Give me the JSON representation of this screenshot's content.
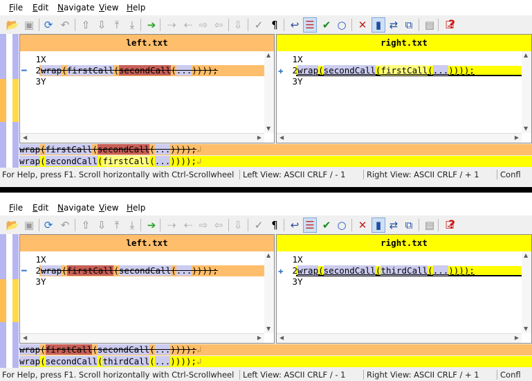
{
  "menu": [
    "File",
    "Edit",
    "Navigate",
    "View",
    "Help"
  ],
  "menu_mnemonics": [
    "F",
    "E",
    "N",
    "V",
    "H"
  ],
  "toolbar_icons": [
    "open-folder-icon",
    "save-icon",
    "refresh-icon",
    "undo-icon",
    "prev-diff-icon",
    "next-diff-icon",
    "first-diff-icon",
    "last-diff-icon",
    "current-diff-icon",
    "copy-left-icon",
    "copy-right-icon",
    "copy-all-icon",
    "prev-conflict-icon",
    "next-conflict-icon",
    "beautify-icon",
    "show-whitespace-icon",
    "word-wrap-icon",
    "view-diffs-icon",
    "check-icon",
    "circle-icon",
    "delete-icon",
    "toggle-panes-icon",
    "swap-panes-icon",
    "compare-icon",
    "options-icon",
    "report-icon",
    "help-icon"
  ],
  "colors": {
    "left_bg": "#ffbe6b",
    "right_bg": "#ffff00",
    "deleted": "#c86058",
    "changed": "#ccccf0",
    "added": "#ffff80",
    "location_pane": "#b6b6f0"
  },
  "shots": [
    {
      "left_title": "left.txt",
      "right_title": "right.txt",
      "left_lines": [
        {
          "num": "1",
          "segments": [
            {
              "text": "X",
              "style": "plain"
            }
          ]
        },
        {
          "num": "2",
          "segments": [
            {
              "text": "wrap",
              "style": "mod strike"
            },
            {
              "text": "(",
              "style": "strike"
            },
            {
              "text": "firstCall",
              "style": "mod strike"
            },
            {
              "text": "(",
              "style": "strike"
            },
            {
              "text": "secondCall",
              "style": "del strike"
            },
            {
              "text": "(",
              "style": "strike"
            },
            {
              "text": "...",
              "style": "mod strike"
            },
            {
              "text": "))));",
              "style": "strike"
            }
          ]
        },
        {
          "num": "3",
          "segments": [
            {
              "text": "Y",
              "style": "plain"
            }
          ]
        }
      ],
      "right_lines": [
        {
          "num": "1",
          "segments": [
            {
              "text": "X",
              "style": "plain"
            }
          ]
        },
        {
          "num": "2",
          "segments": [
            {
              "text": "wrap",
              "style": "mod uline"
            },
            {
              "text": "(",
              "style": "uline"
            },
            {
              "text": "secondCall",
              "style": "mod uline"
            },
            {
              "text": "(",
              "style": "uline"
            },
            {
              "text": "firstCall",
              "style": "add uline"
            },
            {
              "text": "(",
              "style": "uline"
            },
            {
              "text": "...",
              "style": "mod uline"
            },
            {
              "text": "))));",
              "style": "uline"
            }
          ]
        },
        {
          "num": "3",
          "segments": [
            {
              "text": "Y",
              "style": "plain"
            }
          ]
        }
      ],
      "detail_left": [
        {
          "text": "wrap",
          "style": "mod strike"
        },
        {
          "text": "(",
          "style": "strike"
        },
        {
          "text": "firstCall",
          "style": "mod strike"
        },
        {
          "text": "(",
          "style": "strike"
        },
        {
          "text": "secondCall",
          "style": "del strike"
        },
        {
          "text": "(",
          "style": "strike"
        },
        {
          "text": "...",
          "style": "mod strike"
        },
        {
          "text": "))));",
          "style": "strike"
        },
        {
          "text": "↲",
          "style": "eol"
        }
      ],
      "detail_right": [
        {
          "text": "wrap",
          "style": "mod"
        },
        {
          "text": "(",
          "style": "plain"
        },
        {
          "text": "secondCall",
          "style": "mod"
        },
        {
          "text": "(",
          "style": "plain"
        },
        {
          "text": "firstCall",
          "style": "add"
        },
        {
          "text": "(",
          "style": "plain"
        },
        {
          "text": "...",
          "style": "mod"
        },
        {
          "text": "))));",
          "style": "plain"
        },
        {
          "text": "↲",
          "style": "eol"
        }
      ]
    },
    {
      "left_title": "left.txt",
      "right_title": "right.txt",
      "left_lines": [
        {
          "num": "1",
          "segments": [
            {
              "text": "X",
              "style": "plain"
            }
          ]
        },
        {
          "num": "2",
          "segments": [
            {
              "text": "wrap",
              "style": "mod strike"
            },
            {
              "text": "(",
              "style": "strike"
            },
            {
              "text": "firstCall",
              "style": "del strike"
            },
            {
              "text": "(",
              "style": "strike"
            },
            {
              "text": "secondCall",
              "style": "mod strike"
            },
            {
              "text": "(",
              "style": "strike"
            },
            {
              "text": "...",
              "style": "mod strike"
            },
            {
              "text": "))));",
              "style": "strike"
            }
          ]
        },
        {
          "num": "3",
          "segments": [
            {
              "text": "Y",
              "style": "plain"
            }
          ]
        }
      ],
      "right_lines": [
        {
          "num": "1",
          "segments": [
            {
              "text": "X",
              "style": "plain"
            }
          ]
        },
        {
          "num": "2",
          "segments": [
            {
              "text": "wrap",
              "style": "mod uline"
            },
            {
              "text": "(",
              "style": "uline"
            },
            {
              "text": "secondCall",
              "style": "mod uline"
            },
            {
              "text": "(",
              "style": "uline"
            },
            {
              "text": "thirdCall",
              "style": "mod uline"
            },
            {
              "text": "(",
              "style": "uline"
            },
            {
              "text": "...",
              "style": "mod uline"
            },
            {
              "text": "))));",
              "style": "uline"
            }
          ]
        },
        {
          "num": "3",
          "segments": [
            {
              "text": "Y",
              "style": "plain"
            }
          ]
        }
      ],
      "detail_left": [
        {
          "text": "wrap",
          "style": "mod strike"
        },
        {
          "text": "(",
          "style": "strike"
        },
        {
          "text": "firstCall",
          "style": "del strike"
        },
        {
          "text": "(",
          "style": "strike"
        },
        {
          "text": "secondCall",
          "style": "mod strike"
        },
        {
          "text": "(",
          "style": "strike"
        },
        {
          "text": "...",
          "style": "mod strike"
        },
        {
          "text": "))));",
          "style": "strike"
        },
        {
          "text": "↲",
          "style": "eol"
        }
      ],
      "detail_right": [
        {
          "text": "wrap",
          "style": "mod"
        },
        {
          "text": "(",
          "style": "plain"
        },
        {
          "text": "secondCall",
          "style": "mod"
        },
        {
          "text": "(",
          "style": "plain"
        },
        {
          "text": "thirdCall",
          "style": "mod"
        },
        {
          "text": "(",
          "style": "plain"
        },
        {
          "text": "...",
          "style": "mod"
        },
        {
          "text": "))));",
          "style": "plain"
        },
        {
          "text": "↲",
          "style": "eol"
        }
      ]
    }
  ],
  "status": {
    "help": "For Help, press F1. Scroll horizontally with Ctrl-Scrollwheel",
    "left_view": "Left View: ASCII CRLF  / - 1",
    "right_view": "Right View: ASCII CRLF  / + 1",
    "conflicts": "Confl"
  }
}
